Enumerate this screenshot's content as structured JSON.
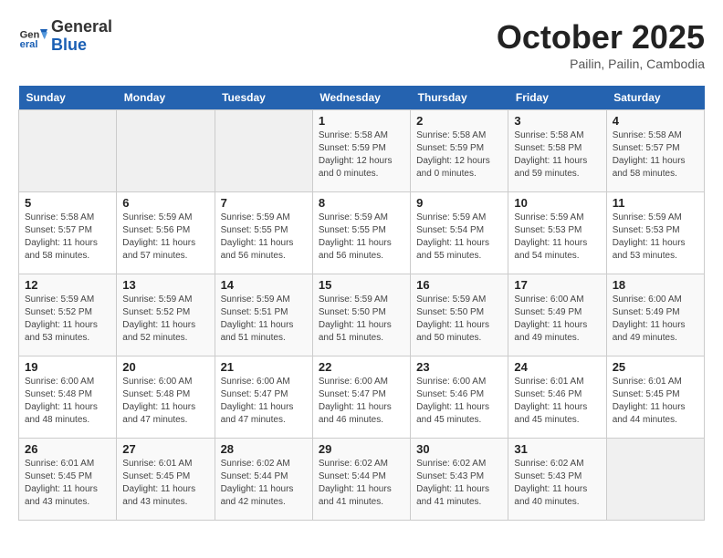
{
  "header": {
    "logo_general": "General",
    "logo_blue": "Blue",
    "month": "October 2025",
    "location": "Pailin, Pailin, Cambodia"
  },
  "weekdays": [
    "Sunday",
    "Monday",
    "Tuesday",
    "Wednesday",
    "Thursday",
    "Friday",
    "Saturday"
  ],
  "weeks": [
    [
      {
        "day": "",
        "sunrise": "",
        "sunset": "",
        "daylight": ""
      },
      {
        "day": "",
        "sunrise": "",
        "sunset": "",
        "daylight": ""
      },
      {
        "day": "",
        "sunrise": "",
        "sunset": "",
        "daylight": ""
      },
      {
        "day": "1",
        "sunrise": "Sunrise: 5:58 AM",
        "sunset": "Sunset: 5:59 PM",
        "daylight": "Daylight: 12 hours and 0 minutes."
      },
      {
        "day": "2",
        "sunrise": "Sunrise: 5:58 AM",
        "sunset": "Sunset: 5:59 PM",
        "daylight": "Daylight: 12 hours and 0 minutes."
      },
      {
        "day": "3",
        "sunrise": "Sunrise: 5:58 AM",
        "sunset": "Sunset: 5:58 PM",
        "daylight": "Daylight: 11 hours and 59 minutes."
      },
      {
        "day": "4",
        "sunrise": "Sunrise: 5:58 AM",
        "sunset": "Sunset: 5:57 PM",
        "daylight": "Daylight: 11 hours and 58 minutes."
      }
    ],
    [
      {
        "day": "5",
        "sunrise": "Sunrise: 5:58 AM",
        "sunset": "Sunset: 5:57 PM",
        "daylight": "Daylight: 11 hours and 58 minutes."
      },
      {
        "day": "6",
        "sunrise": "Sunrise: 5:59 AM",
        "sunset": "Sunset: 5:56 PM",
        "daylight": "Daylight: 11 hours and 57 minutes."
      },
      {
        "day": "7",
        "sunrise": "Sunrise: 5:59 AM",
        "sunset": "Sunset: 5:55 PM",
        "daylight": "Daylight: 11 hours and 56 minutes."
      },
      {
        "day": "8",
        "sunrise": "Sunrise: 5:59 AM",
        "sunset": "Sunset: 5:55 PM",
        "daylight": "Daylight: 11 hours and 56 minutes."
      },
      {
        "day": "9",
        "sunrise": "Sunrise: 5:59 AM",
        "sunset": "Sunset: 5:54 PM",
        "daylight": "Daylight: 11 hours and 55 minutes."
      },
      {
        "day": "10",
        "sunrise": "Sunrise: 5:59 AM",
        "sunset": "Sunset: 5:53 PM",
        "daylight": "Daylight: 11 hours and 54 minutes."
      },
      {
        "day": "11",
        "sunrise": "Sunrise: 5:59 AM",
        "sunset": "Sunset: 5:53 PM",
        "daylight": "Daylight: 11 hours and 53 minutes."
      }
    ],
    [
      {
        "day": "12",
        "sunrise": "Sunrise: 5:59 AM",
        "sunset": "Sunset: 5:52 PM",
        "daylight": "Daylight: 11 hours and 53 minutes."
      },
      {
        "day": "13",
        "sunrise": "Sunrise: 5:59 AM",
        "sunset": "Sunset: 5:52 PM",
        "daylight": "Daylight: 11 hours and 52 minutes."
      },
      {
        "day": "14",
        "sunrise": "Sunrise: 5:59 AM",
        "sunset": "Sunset: 5:51 PM",
        "daylight": "Daylight: 11 hours and 51 minutes."
      },
      {
        "day": "15",
        "sunrise": "Sunrise: 5:59 AM",
        "sunset": "Sunset: 5:50 PM",
        "daylight": "Daylight: 11 hours and 51 minutes."
      },
      {
        "day": "16",
        "sunrise": "Sunrise: 5:59 AM",
        "sunset": "Sunset: 5:50 PM",
        "daylight": "Daylight: 11 hours and 50 minutes."
      },
      {
        "day": "17",
        "sunrise": "Sunrise: 6:00 AM",
        "sunset": "Sunset: 5:49 PM",
        "daylight": "Daylight: 11 hours and 49 minutes."
      },
      {
        "day": "18",
        "sunrise": "Sunrise: 6:00 AM",
        "sunset": "Sunset: 5:49 PM",
        "daylight": "Daylight: 11 hours and 49 minutes."
      }
    ],
    [
      {
        "day": "19",
        "sunrise": "Sunrise: 6:00 AM",
        "sunset": "Sunset: 5:48 PM",
        "daylight": "Daylight: 11 hours and 48 minutes."
      },
      {
        "day": "20",
        "sunrise": "Sunrise: 6:00 AM",
        "sunset": "Sunset: 5:48 PM",
        "daylight": "Daylight: 11 hours and 47 minutes."
      },
      {
        "day": "21",
        "sunrise": "Sunrise: 6:00 AM",
        "sunset": "Sunset: 5:47 PM",
        "daylight": "Daylight: 11 hours and 47 minutes."
      },
      {
        "day": "22",
        "sunrise": "Sunrise: 6:00 AM",
        "sunset": "Sunset: 5:47 PM",
        "daylight": "Daylight: 11 hours and 46 minutes."
      },
      {
        "day": "23",
        "sunrise": "Sunrise: 6:00 AM",
        "sunset": "Sunset: 5:46 PM",
        "daylight": "Daylight: 11 hours and 45 minutes."
      },
      {
        "day": "24",
        "sunrise": "Sunrise: 6:01 AM",
        "sunset": "Sunset: 5:46 PM",
        "daylight": "Daylight: 11 hours and 45 minutes."
      },
      {
        "day": "25",
        "sunrise": "Sunrise: 6:01 AM",
        "sunset": "Sunset: 5:45 PM",
        "daylight": "Daylight: 11 hours and 44 minutes."
      }
    ],
    [
      {
        "day": "26",
        "sunrise": "Sunrise: 6:01 AM",
        "sunset": "Sunset: 5:45 PM",
        "daylight": "Daylight: 11 hours and 43 minutes."
      },
      {
        "day": "27",
        "sunrise": "Sunrise: 6:01 AM",
        "sunset": "Sunset: 5:45 PM",
        "daylight": "Daylight: 11 hours and 43 minutes."
      },
      {
        "day": "28",
        "sunrise": "Sunrise: 6:02 AM",
        "sunset": "Sunset: 5:44 PM",
        "daylight": "Daylight: 11 hours and 42 minutes."
      },
      {
        "day": "29",
        "sunrise": "Sunrise: 6:02 AM",
        "sunset": "Sunset: 5:44 PM",
        "daylight": "Daylight: 11 hours and 41 minutes."
      },
      {
        "day": "30",
        "sunrise": "Sunrise: 6:02 AM",
        "sunset": "Sunset: 5:43 PM",
        "daylight": "Daylight: 11 hours and 41 minutes."
      },
      {
        "day": "31",
        "sunrise": "Sunrise: 6:02 AM",
        "sunset": "Sunset: 5:43 PM",
        "daylight": "Daylight: 11 hours and 40 minutes."
      },
      {
        "day": "",
        "sunrise": "",
        "sunset": "",
        "daylight": ""
      }
    ]
  ]
}
